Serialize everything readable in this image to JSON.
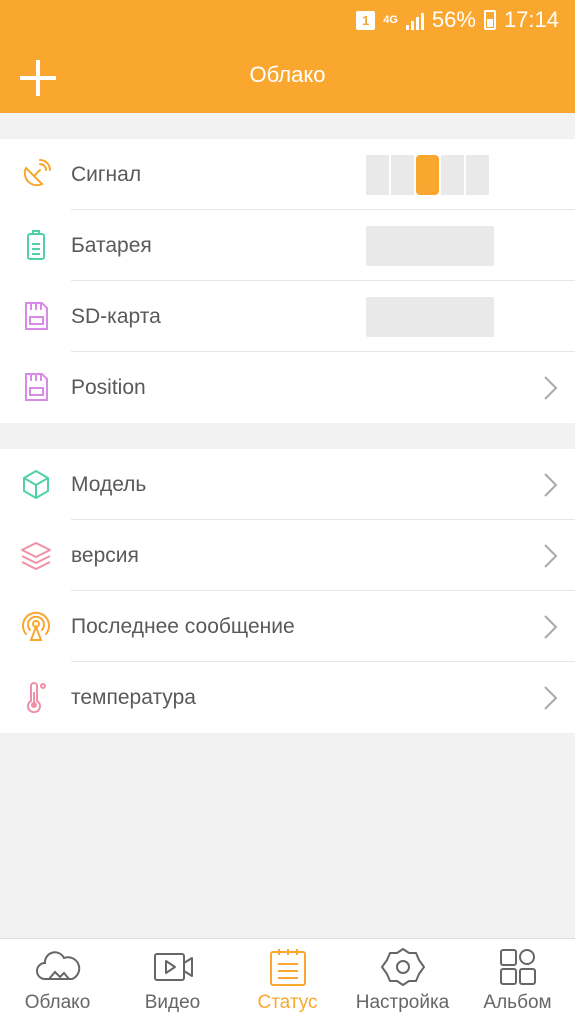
{
  "status_bar": {
    "sim": "1",
    "network": "4G",
    "battery_percent": "56%",
    "time": "17:14"
  },
  "header": {
    "title": "Облако"
  },
  "colors": {
    "accent": "#f9a72f",
    "background": "#f2f2f2"
  },
  "device_group": [
    {
      "label": "Сигнал",
      "icon": "satellite-icon",
      "value_widget": "signal-bars",
      "signal_level": 3,
      "signal_max": 5
    },
    {
      "label": "Батарея",
      "icon": "battery-icon",
      "value_widget": "empty-field"
    },
    {
      "label": "SD-карта",
      "icon": "sd-card-icon",
      "value_widget": "empty-field"
    },
    {
      "label": "Position",
      "icon": "sd-card-icon",
      "value_widget": "chevron"
    }
  ],
  "info_group": [
    {
      "label": "Модель",
      "icon": "cube-icon"
    },
    {
      "label": "версия",
      "icon": "layers-icon"
    },
    {
      "label": "Последнее сообщение",
      "icon": "broadcast-icon"
    },
    {
      "label": "температура",
      "icon": "thermometer-icon"
    }
  ],
  "tabs": [
    {
      "label": "Облако",
      "icon": "cloud-icon",
      "active": false
    },
    {
      "label": "Видео",
      "icon": "video-icon",
      "active": false
    },
    {
      "label": "Статус",
      "icon": "clipboard-icon",
      "active": true
    },
    {
      "label": "Настройка",
      "icon": "gear-icon",
      "active": false
    },
    {
      "label": "Альбом",
      "icon": "grid-icon",
      "active": false
    }
  ]
}
